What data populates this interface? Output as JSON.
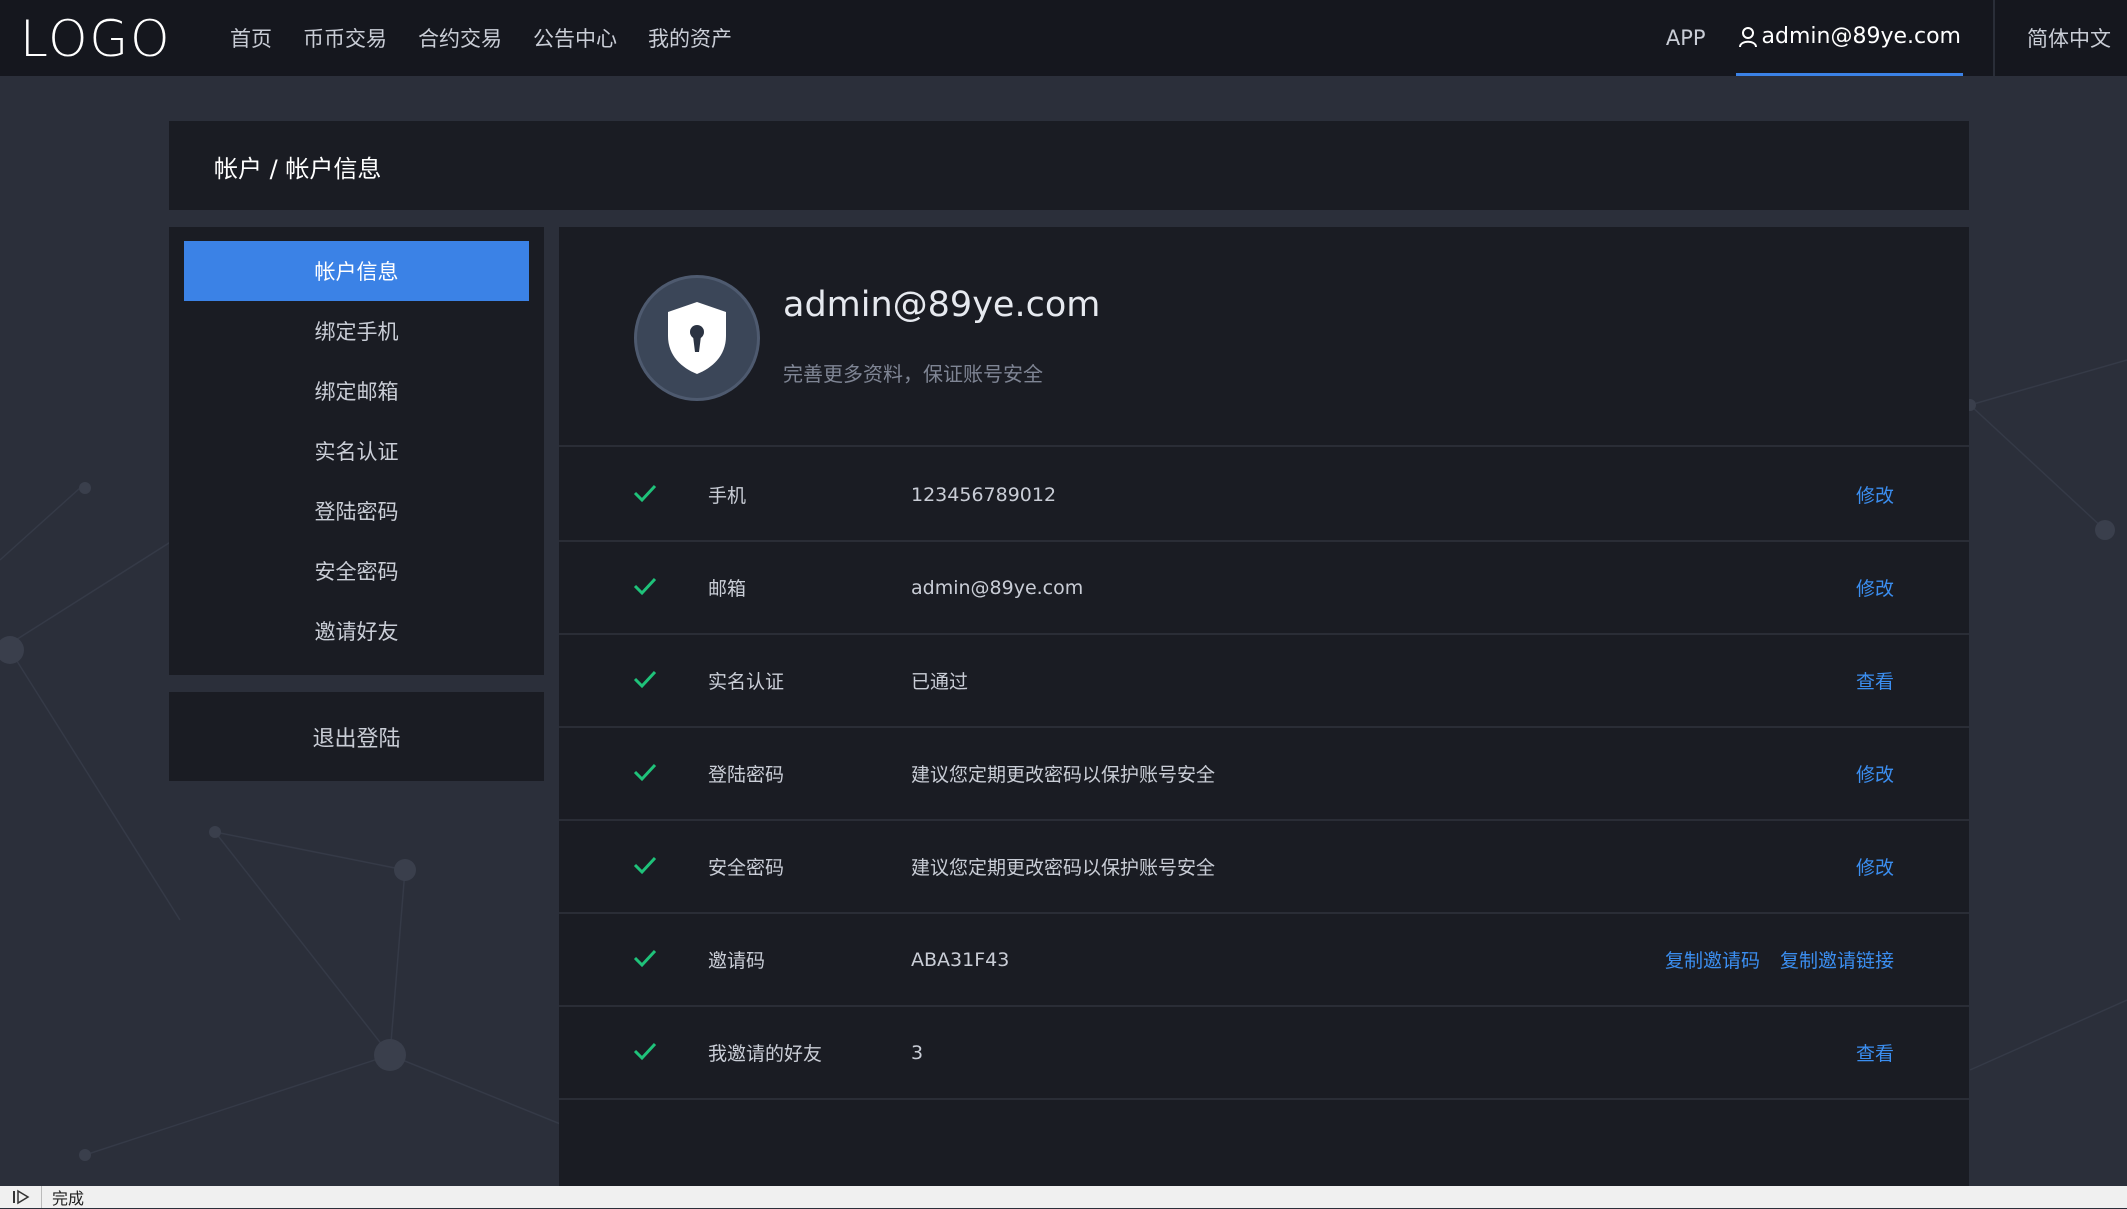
{
  "header": {
    "logo": "LOGO",
    "nav": [
      "首页",
      "币币交易",
      "合约交易",
      "公告中心",
      "我的资产"
    ],
    "app_label": "APP",
    "user": "admin@89ye.com",
    "language": "简体中文"
  },
  "breadcrumb": "帐户 / 帐户信息",
  "sidebar": {
    "items": [
      {
        "label": "帐户信息",
        "active": true
      },
      {
        "label": "绑定手机"
      },
      {
        "label": "绑定邮箱"
      },
      {
        "label": "实名认证"
      },
      {
        "label": "登陆密码"
      },
      {
        "label": "安全密码"
      },
      {
        "label": "邀请好友"
      }
    ],
    "logout": "退出登陆"
  },
  "profile": {
    "name": "admin@89ye.com",
    "subtitle": "完善更多资料，保证账号安全"
  },
  "rows": [
    {
      "label": "手机",
      "value": "123456789012",
      "actions": [
        "修改"
      ]
    },
    {
      "label": "邮箱",
      "value": "admin@89ye.com",
      "actions": [
        "修改"
      ]
    },
    {
      "label": "实名认证",
      "value": "已通过",
      "actions": [
        "查看"
      ]
    },
    {
      "label": "登陆密码",
      "value": "建议您定期更改密码以保护账号安全",
      "actions": [
        "修改"
      ]
    },
    {
      "label": "安全密码",
      "value": "建议您定期更改密码以保护账号安全",
      "actions": [
        "修改"
      ]
    },
    {
      "label": "邀请码",
      "value": "ABA31F43",
      "actions": [
        "复制邀请码",
        "复制邀请链接"
      ]
    },
    {
      "label": "我邀请的好友",
      "value": "3",
      "actions": [
        "查看"
      ]
    }
  ],
  "statusbar": {
    "text": "完成"
  },
  "colors": {
    "accent": "#3b82e6",
    "link": "#3b8ef0",
    "check": "#1fc27a",
    "panel": "#1a1c23",
    "background": "#2b2f3a"
  }
}
